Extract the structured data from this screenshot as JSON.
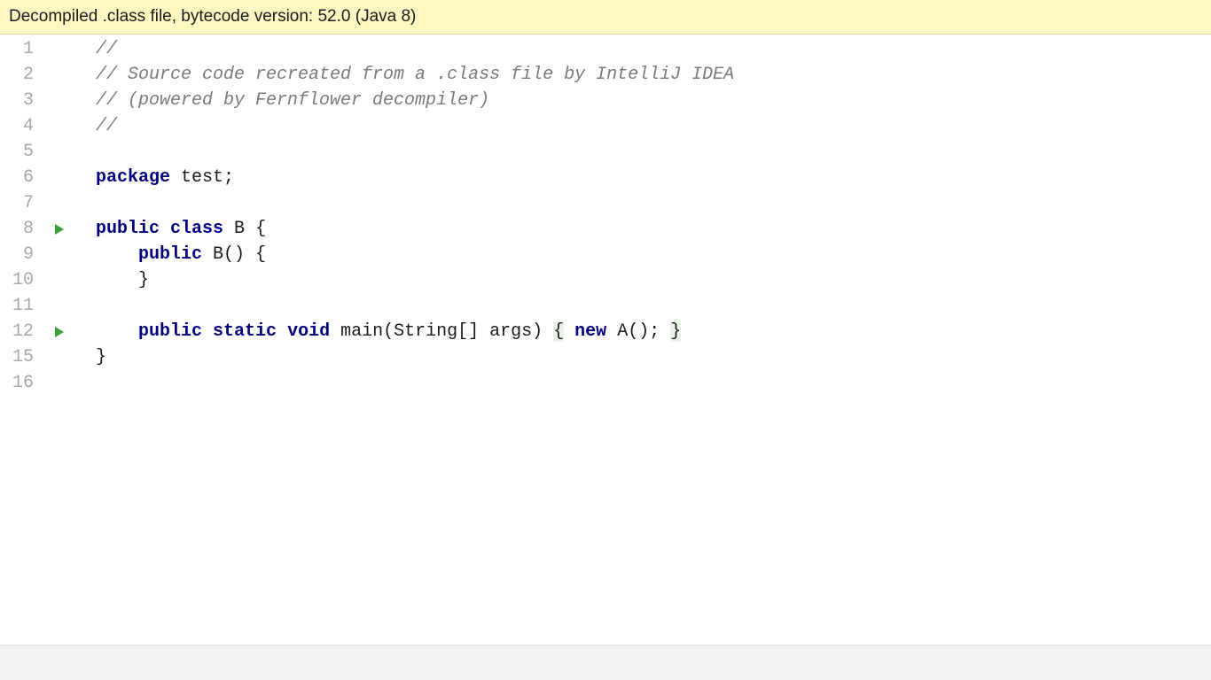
{
  "banner": {
    "text": "Decompiled .class file, bytecode version: 52.0 (Java 8)"
  },
  "gutter": {
    "lines": [
      "1",
      "2",
      "3",
      "4",
      "5",
      "6",
      "7",
      "8",
      "9",
      "10",
      "11",
      "12",
      "15",
      "16"
    ]
  },
  "run_markers": {
    "rows": [
      7,
      11
    ]
  },
  "code": {
    "c1": "//",
    "c2": "// Source code recreated from a .class file by IntelliJ IDEA",
    "c3": "// (powered by Fernflower decompiler)",
    "c4": "//",
    "kw_package": "package",
    "pkg_rest": " test;",
    "kw_public": "public",
    "kw_class": "class",
    "class_name": " B ",
    "brace_open": "{",
    "ctor_public": "public",
    "ctor_rest": " B() {",
    "ctor_close": "}",
    "kw_static": "static",
    "kw_void": "void",
    "main_sig": " main(String[] args) ",
    "kw_new": "new",
    "new_rest": " A(); ",
    "brace_close_main": "}",
    "brace_close_class": "}"
  }
}
